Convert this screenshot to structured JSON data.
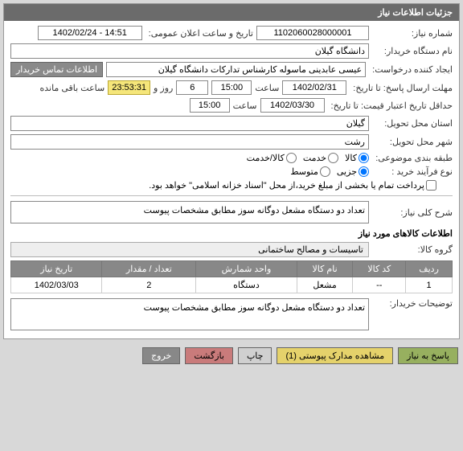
{
  "header": {
    "title": "جزئیات اطلاعات نیاز"
  },
  "fields": {
    "need_no_label": "شماره نیاز:",
    "need_no": "1102060028000001",
    "announce_label": "تاریخ و ساعت اعلان عمومی:",
    "announce_value": "1402/02/24 - 14:51",
    "buyer_label": "نام دستگاه خریدار:",
    "buyer_value": "دانشگاه گیلان",
    "creator_label": "ایجاد کننده درخواست:",
    "creator_value": "عیسی عابدینی ماسوله کارشناس تدارکات دانشگاه گیلان",
    "contact_btn": "اطلاعات تماس خریدار",
    "deadline_label": "مهلت ارسال پاسخ: تا تاریخ:",
    "deadline_date": "1402/02/31",
    "deadline_time_lbl": "ساعت",
    "deadline_time": "15:00",
    "days_val": "6",
    "days_lbl": "روز و",
    "countdown": "23:53:31",
    "remain_lbl": "ساعت باقی مانده",
    "validity_label": "حداقل تاریخ اعتبار قیمت: تا تاریخ:",
    "validity_date": "1402/03/30",
    "validity_time": "15:00",
    "province_label": "استان محل تحویل:",
    "province_value": "گیلان",
    "city_label": "شهر محل تحویل:",
    "city_value": "رشت",
    "category_label": "طبقه بندی موضوعی:",
    "cat_goods": "کالا",
    "cat_service": "خدمت",
    "cat_both": "کالا/خدمت",
    "process_label": "نوع فرآیند خرید :",
    "proc_partial": "جزیی",
    "proc_medium": "متوسط",
    "pay_note": "پرداخت تمام یا بخشی از مبلغ خرید،از محل \"اسناد خزانه اسلامی\" خواهد بود.",
    "summary_label": "شرح کلی نیاز:",
    "summary_value": "تعداد دو دستگاه مشعل دوگانه سوز مطابق مشخصات پیوست",
    "items_heading": "اطلاعات کالاهای مورد نیاز",
    "group_label": "گروه کالا:",
    "group_value": "تاسیسات و مصالح ساختمانی",
    "buyer_desc_label": "توضیحات خریدار:",
    "buyer_desc_value": "تعداد دو دستگاه مشعل دوگانه سوز مطابق مشخصات پیوست"
  },
  "table": {
    "headers": {
      "row": "ردیف",
      "code": "کد کالا",
      "name": "نام کالا",
      "unit": "واحد شمارش",
      "qty": "تعداد / مقدار",
      "date": "تاریخ نیاز"
    },
    "rows": [
      {
        "row": "1",
        "code": "--",
        "name": "مشعل",
        "unit": "دستگاه",
        "qty": "2",
        "date": "1402/03/03"
      }
    ]
  },
  "buttons": {
    "respond": "پاسخ به نیاز",
    "attachments": "مشاهده مدارک پیوستی (1)",
    "print": "چاپ",
    "back": "بازگشت",
    "exit": "خروج"
  }
}
